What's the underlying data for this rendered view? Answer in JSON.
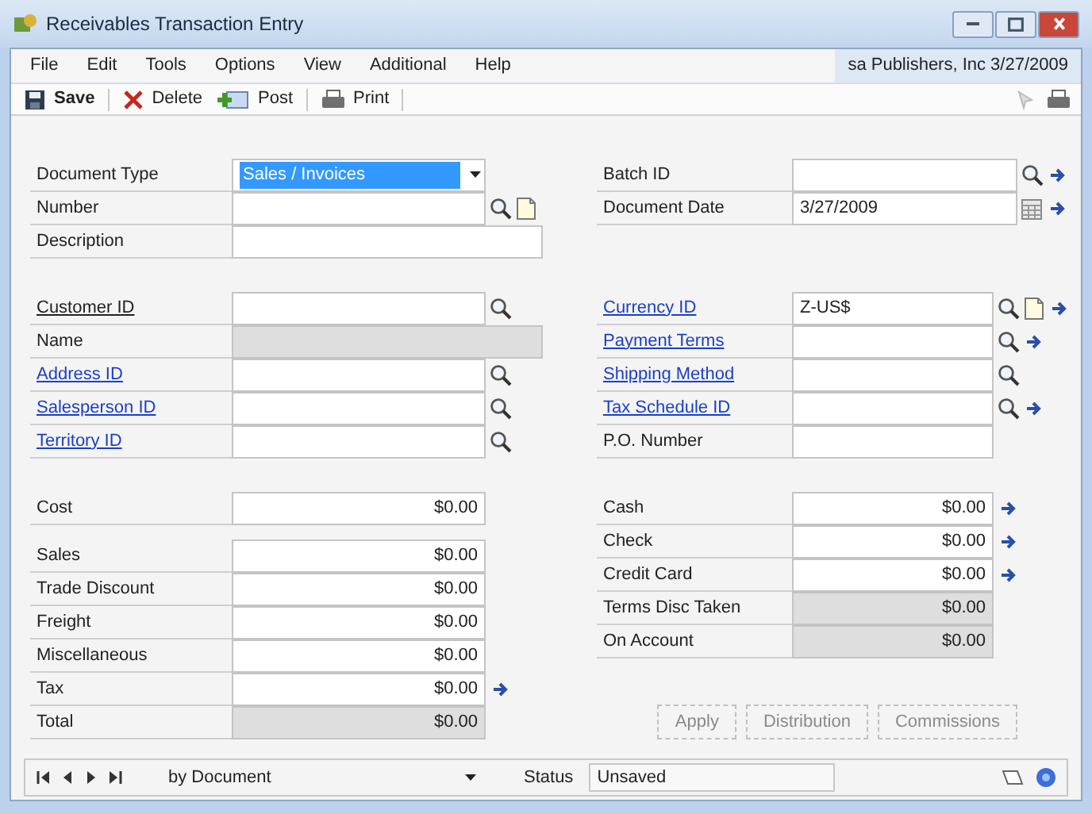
{
  "window": {
    "title": "Receivables Transaction Entry"
  },
  "menu": [
    "File",
    "Edit",
    "Tools",
    "Options",
    "View",
    "Additional",
    "Help"
  ],
  "user_info": "sa  Publishers, Inc  3/27/2009",
  "toolbar": [
    {
      "kind": "save",
      "label": "Save"
    },
    {
      "kind": "delete",
      "label": "Delete"
    },
    {
      "kind": "post",
      "label": "Post"
    },
    {
      "kind": "print",
      "label": "Print"
    }
  ],
  "sections": [
    {
      "left": [
        {
          "label": "Document Type",
          "link": false,
          "kind": "dropdown",
          "value": "Sales / Invoices",
          "editable": true
        },
        {
          "label": "Number",
          "link": false,
          "kind": "text",
          "editable": true,
          "lookup": true,
          "note": true
        },
        {
          "label": "Description",
          "link": false,
          "kind": "text",
          "editable": true
        }
      ],
      "right": [
        {
          "label": "Batch ID",
          "link": false,
          "kind": "text",
          "editable": true,
          "lookup": true,
          "arrow": true
        },
        {
          "label": "Document Date",
          "link": false,
          "kind": "text",
          "value": "3/27/2009",
          "editable": true,
          "calendar": true,
          "arrow": true
        }
      ]
    },
    {
      "left": [
        {
          "label": "Customer ID",
          "link": false,
          "underlined": true,
          "kind": "text",
          "editable": true,
          "lookup": true
        },
        {
          "label": "Name",
          "link": false,
          "kind": "text",
          "editable": false
        },
        {
          "label": "Address ID",
          "link": true,
          "kind": "text",
          "editable": true,
          "lookup": true
        },
        {
          "label": "Salesperson ID",
          "link": true,
          "kind": "text",
          "editable": true,
          "lookup": true
        },
        {
          "label": "Territory ID",
          "link": true,
          "kind": "text",
          "editable": true,
          "lookup": true
        }
      ],
      "right": [
        {
          "label": "Currency ID",
          "link": true,
          "kind": "text",
          "value": "Z-US$",
          "editable": true,
          "lookup": true,
          "note": true,
          "arrow": true
        },
        {
          "label": "Payment Terms",
          "link": true,
          "kind": "text",
          "editable": true,
          "lookup": true,
          "arrow": true
        },
        {
          "label": "Shipping Method",
          "link": true,
          "kind": "text",
          "editable": true,
          "lookup": true
        },
        {
          "label": "Tax Schedule ID",
          "link": true,
          "kind": "text",
          "editable": true,
          "lookup": true,
          "arrow": true
        },
        {
          "label": "P.O. Number",
          "link": false,
          "kind": "text",
          "editable": true
        }
      ]
    },
    {
      "left": [
        {
          "label": "Cost",
          "link": false,
          "kind": "amount",
          "value": "$0.00",
          "editable": true
        },
        {
          "label": "Sales",
          "link": false,
          "kind": "amount",
          "value": "$0.00",
          "editable": true
        },
        {
          "label": "Trade Discount",
          "link": false,
          "kind": "amount",
          "value": "$0.00",
          "editable": true
        },
        {
          "label": "Freight",
          "link": false,
          "kind": "amount",
          "value": "$0.00",
          "editable": true
        },
        {
          "label": "Miscellaneous",
          "link": false,
          "kind": "amount",
          "value": "$0.00",
          "editable": true
        },
        {
          "label": "Tax",
          "link": false,
          "kind": "amount",
          "value": "$0.00",
          "editable": true,
          "arrow": true
        },
        {
          "label": "Total",
          "link": false,
          "kind": "amount",
          "value": "$0.00",
          "editable": false
        }
      ],
      "right": [
        {
          "label": "Cash",
          "link": false,
          "kind": "amount",
          "value": "$0.00",
          "editable": true,
          "arrow": true
        },
        {
          "label": "Check",
          "link": false,
          "kind": "amount",
          "value": "$0.00",
          "editable": true,
          "arrow": true
        },
        {
          "label": "Credit Card",
          "link": false,
          "kind": "amount",
          "value": "$0.00",
          "editable": true,
          "arrow": true
        },
        {
          "label": "Terms Disc Taken",
          "link": false,
          "kind": "amount",
          "value": "$0.00",
          "editable": false
        },
        {
          "label": "On Account",
          "link": false,
          "kind": "amount",
          "value": "$0.00",
          "editable": false
        }
      ]
    }
  ],
  "action_buttons": [
    {
      "label": "Apply",
      "disabled": true
    },
    {
      "label": "Distribution",
      "disabled": true
    },
    {
      "label": "Commissions",
      "disabled": true
    }
  ],
  "browse_bar": {
    "nav": [
      {
        "kind": "first"
      },
      {
        "kind": "previous"
      },
      {
        "kind": "next"
      },
      {
        "kind": "last"
      }
    ],
    "sort": "by Document",
    "status_label": "Status",
    "status": "Unsaved"
  }
}
